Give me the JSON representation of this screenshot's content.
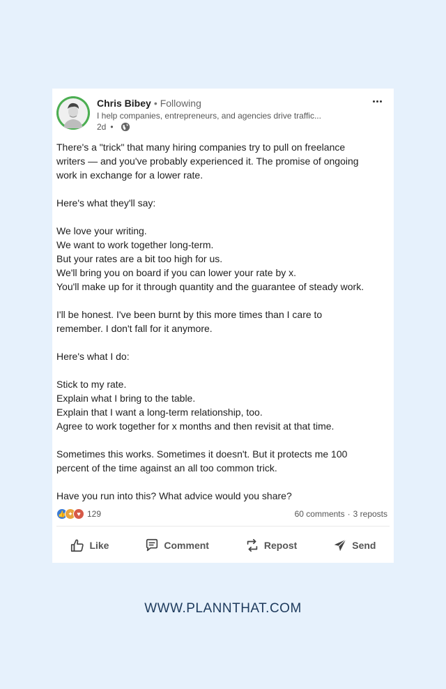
{
  "post": {
    "author": {
      "name": "Chris Bibey",
      "separator": "•",
      "follow_status": "Following",
      "headline": "I help companies, entrepreneurs, and agencies drive traffic...",
      "age": "2d",
      "meta_separator": "•",
      "visibility_icon": "globe-icon"
    },
    "more_icon": "more-horizontal-icon",
    "body": [
      [
        "There's a \"trick\" that many hiring companies try to pull on freelance",
        "writers — and you've probably experienced it. The promise of ongoing",
        "work in exchange for a lower rate."
      ],
      [
        "Here's what they'll say:"
      ],
      [
        "We love your writing.",
        "We want to work together long-term.",
        "But your rates are a bit too high for us.",
        "We'll bring you on board if you can lower your rate by x.",
        "You'll make up for it through quantity and the guarantee of steady work."
      ],
      [
        "I'll be honest. I've been burnt by this more times than I care to",
        "remember. I don't fall for it anymore."
      ],
      [
        "Here's what I do:"
      ],
      [
        "Stick to my rate.",
        "Explain what I bring to the table.",
        "Explain that I want a long-term relationship, too.",
        "Agree to work together for x months and then revisit at that time."
      ],
      [
        "Sometimes this works. Sometimes it doesn't. But it protects me 100",
        "percent of the time against an all too common trick."
      ],
      [
        "Have you run into this? What advice would you share?"
      ]
    ],
    "reactions": {
      "icons": [
        "like-reaction-icon",
        "celebrate-reaction-icon",
        "love-reaction-icon"
      ],
      "count": "129"
    },
    "comments": "60 comments",
    "stats_separator": "·",
    "reposts": "3 reposts",
    "actions": {
      "like": "Like",
      "comment": "Comment",
      "repost": "Repost",
      "send": "Send"
    }
  },
  "footer": {
    "url": "WWW.PLANNTHAT.COM"
  },
  "colors": {
    "background": "#e6f1fc",
    "avatar_ring": "#4cae52",
    "footer_text": "#1d3a5c",
    "like_blue": "#3a7bd5"
  }
}
